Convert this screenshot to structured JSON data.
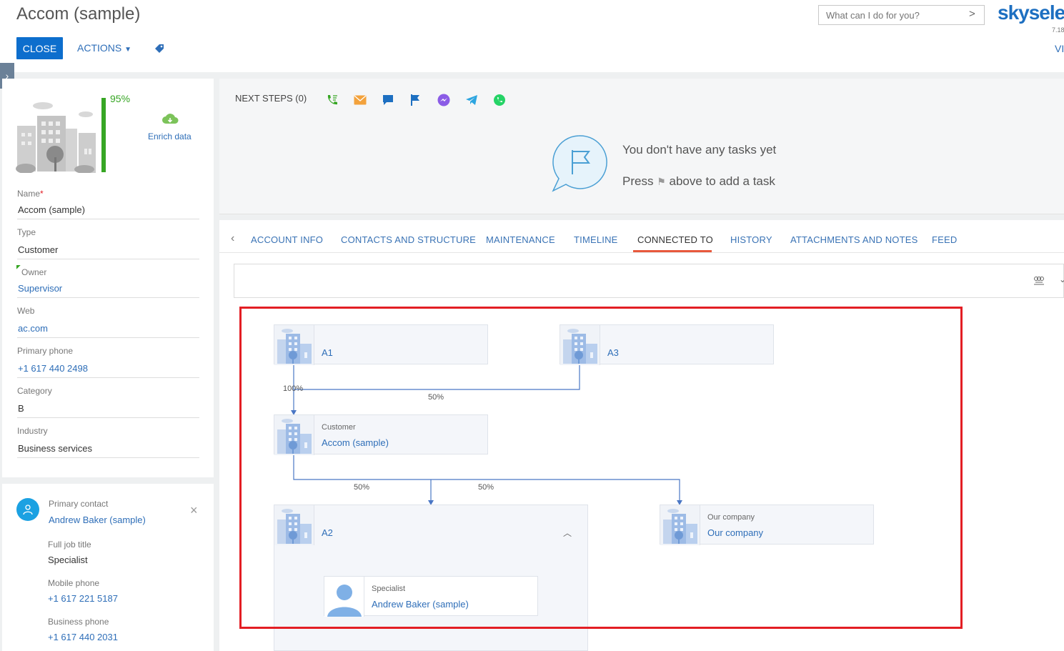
{
  "header": {
    "title": "Accom (sample)",
    "close_label": "CLOSE",
    "actions_label": "ACTIONS",
    "search_placeholder": "What can I do for you?",
    "logo": "skysele",
    "version": "7.18",
    "view_label": "VI"
  },
  "profile": {
    "completeness": "95%",
    "completeness_value": 0.95,
    "enrich_label": "Enrich data",
    "fields": [
      {
        "label": "Name",
        "required": true,
        "value": "Accom (sample)",
        "is_link": false
      },
      {
        "label": "Type",
        "value": "Customer",
        "is_link": false
      },
      {
        "label": "Owner",
        "value": "Supervisor",
        "is_link": true
      },
      {
        "label": "Web",
        "value": "ac.com",
        "is_link": true
      },
      {
        "label": "Primary phone",
        "value": "+1 617 440 2498",
        "is_link": true
      },
      {
        "label": "Category",
        "value": "B",
        "is_link": false
      },
      {
        "label": "Industry",
        "value": "Business services",
        "is_link": false
      }
    ],
    "required_mark": "*"
  },
  "contact": {
    "label": "Primary contact",
    "name": "Andrew Baker (sample)",
    "job_title_label": "Full job title",
    "job_title": "Specialist",
    "mobile_label": "Mobile phone",
    "mobile": "+1 617 221 5187",
    "business_label": "Business phone",
    "business": "+1 617 440 2031"
  },
  "next_steps": {
    "title": "NEXT STEPS (0)",
    "empty_title": "You don't have any tasks yet",
    "press_prefix": "Press",
    "press_suffix": "above to add a task",
    "icons": [
      "phone-icon",
      "email-icon",
      "chat-icon",
      "flag-icon",
      "messenger-icon",
      "telegram-icon",
      "whatsapp-icon"
    ]
  },
  "tabs": [
    {
      "label": "ACCOUNT INFO"
    },
    {
      "label": "CONTACTS AND STRUCTURE"
    },
    {
      "label": "MAINTENANCE"
    },
    {
      "label": "TIMELINE"
    },
    {
      "label": "CONNECTED TO",
      "active": true
    },
    {
      "label": "HISTORY"
    },
    {
      "label": "ATTACHMENTS AND NOTES"
    },
    {
      "label": "FEED"
    }
  ],
  "diagram": {
    "nodes": {
      "a1": {
        "title": "A1"
      },
      "a3": {
        "title": "A3"
      },
      "customer": {
        "subtitle": "Customer",
        "title": "Accom (sample)"
      },
      "a2": {
        "title": "A2"
      },
      "our_company": {
        "subtitle": "Our company",
        "title": "Our company"
      },
      "specialist": {
        "subtitle": "Specialist",
        "title": "Andrew Baker (sample)"
      }
    },
    "edge_labels": {
      "a1_customer": "100%",
      "a3_customer": "50%",
      "customer_a2": "50%",
      "customer_our": "50%"
    }
  },
  "colors": {
    "primary": "#0d6ecd",
    "link": "#2e6eb8",
    "completeness": "#37a624",
    "tab_active": "#e8593c",
    "highlight_frame": "#e31e24"
  }
}
